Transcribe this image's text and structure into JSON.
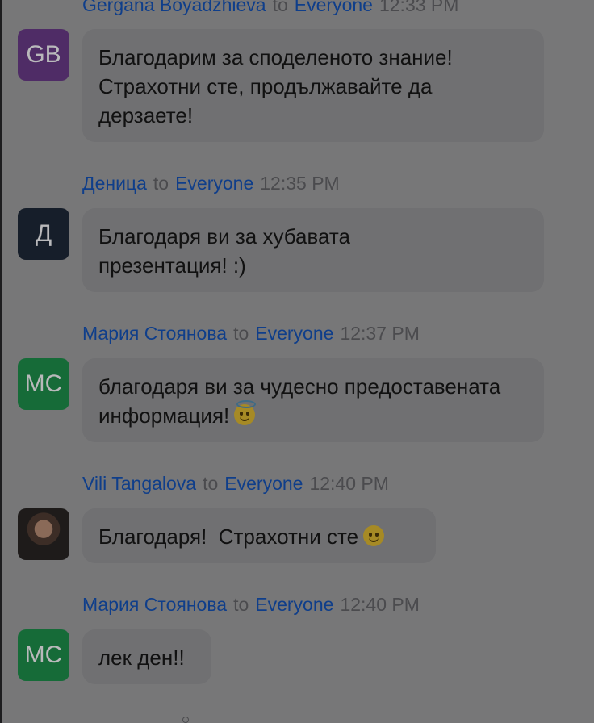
{
  "to_label": "to",
  "messages": [
    {
      "sender": "Gergana Boyadzhieva",
      "recipient": "Everyone",
      "time": "12:33 PM",
      "avatar_initials": "GB",
      "avatar_color": "#4f2c66",
      "text": "Благодарим за споделеното знание! Страхотни сте, продължавайте да дерзаете!"
    },
    {
      "sender": "Деница",
      "recipient": "Everyone",
      "time": "12:35 PM",
      "avatar_initials": "Д",
      "avatar_color": "#161e2a",
      "text": "Благодаря ви за хубавата презентация! :)"
    },
    {
      "sender": "Мария Стоянова",
      "recipient": "Everyone",
      "time": "12:37 PM",
      "avatar_initials": "МС",
      "avatar_color": "#166b38",
      "text": "благодаря ви за чудесно предоставената информация!",
      "emoji": "smiling-face-with-halo"
    },
    {
      "sender": "Vili Tangalova",
      "recipient": "Everyone",
      "time": "12:40 PM",
      "avatar_type": "photo",
      "text": "Благодаря!  Страхотни сте",
      "emoji": "slightly-smiling-face"
    },
    {
      "sender": "Мария Стоянова",
      "recipient": "Everyone",
      "time": "12:40 PM",
      "avatar_initials": "МС",
      "avatar_color": "#166b38",
      "text": "лек ден!!"
    }
  ]
}
